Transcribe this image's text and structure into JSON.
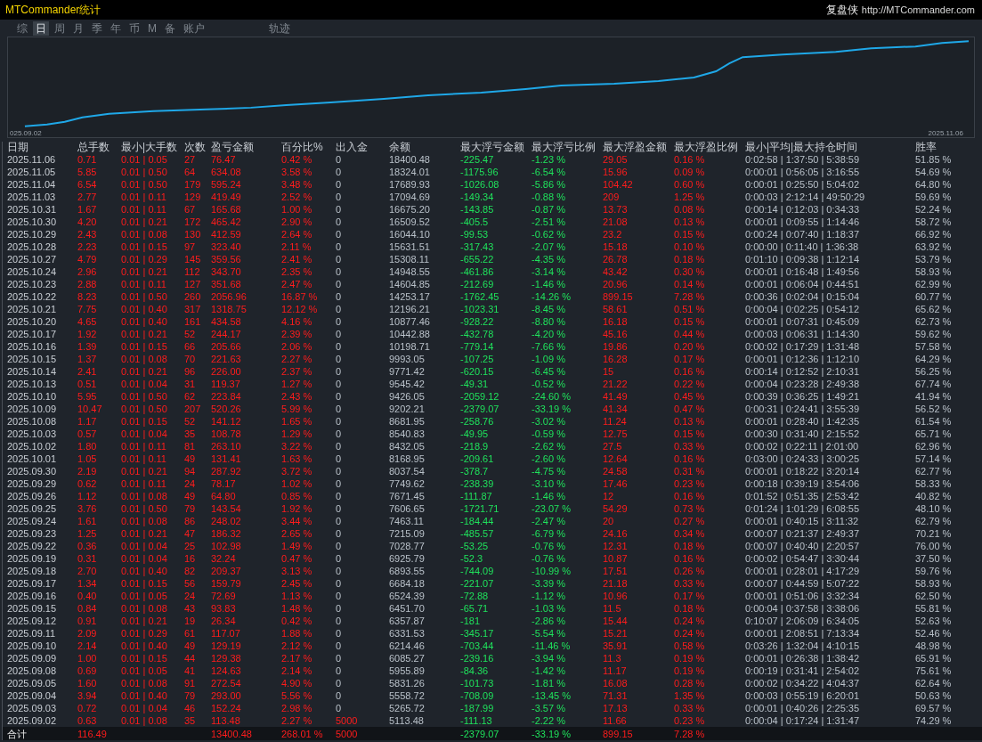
{
  "window": {
    "title": "MTCommander统计",
    "brand": "复盘侠",
    "url": "http://MTCommander.com"
  },
  "tabs": [
    {
      "label": "综",
      "selected": false
    },
    {
      "label": "日",
      "selected": true
    },
    {
      "label": "周",
      "selected": false
    },
    {
      "label": "月",
      "selected": false
    },
    {
      "label": "季",
      "selected": false
    },
    {
      "label": "年",
      "selected": false
    },
    {
      "label": "币",
      "selected": false
    },
    {
      "label": "M",
      "selected": false
    },
    {
      "label": "备",
      "selected": false
    },
    {
      "label": "账户",
      "selected": false
    }
  ],
  "right_tabs": [
    {
      "label": "轨迹",
      "selected": false
    }
  ],
  "chart": {
    "start_label": "025.09.02",
    "end_label": "2025.11.06"
  },
  "table": {
    "columns": [
      {
        "label": "日期",
        "kind": "label"
      },
      {
        "label": "总手数",
        "kind": "up"
      },
      {
        "label": "最小|大手数",
        "kind": "up"
      },
      {
        "label": "次数",
        "kind": "up"
      },
      {
        "label": "盈亏金额",
        "kind": "up"
      },
      {
        "label": "百分比%",
        "kind": "up"
      },
      {
        "label": "出入金",
        "kind": "transfer"
      },
      {
        "label": "余额",
        "kind": "plain"
      },
      {
        "label": "最大浮亏金额",
        "kind": "down"
      },
      {
        "label": "最大浮亏比例",
        "kind": "down"
      },
      {
        "label": "最大浮盈金额",
        "kind": "up"
      },
      {
        "label": "最大浮盈比例",
        "kind": "up"
      },
      {
        "label": "最小|平均|最大持仓时间",
        "kind": "plain"
      },
      {
        "label": "胜率",
        "kind": "plain"
      }
    ],
    "rows": [
      {
        "cells": [
          "2025.11.06",
          "0.71",
          "0.01 | 0.05",
          "27",
          "76.47",
          "0.42 %",
          "0",
          "18400.48",
          "-225.47",
          "-1.23 %",
          "29.05",
          "0.16 %",
          "0:02:58 | 1:37:50 | 5:38:59",
          "51.85 %"
        ],
        "transfer": false
      },
      {
        "cells": [
          "2025.11.05",
          "5.85",
          "0.01 | 0.50",
          "64",
          "634.08",
          "3.58 %",
          "0",
          "18324.01",
          "-1175.96",
          "-6.54 %",
          "15.96",
          "0.09 %",
          "0:00:01 | 0:56:05 | 3:16:55",
          "54.69 %"
        ],
        "transfer": false
      },
      {
        "cells": [
          "2025.11.04",
          "6.54",
          "0.01 | 0.50",
          "179",
          "595.24",
          "3.48 %",
          "0",
          "17689.93",
          "-1026.08",
          "-5.86 %",
          "104.42",
          "0.60 %",
          "0:00:01 | 0:25:50 | 5:04:02",
          "64.80 %"
        ],
        "transfer": false
      },
      {
        "cells": [
          "2025.11.03",
          "2.77",
          "0.01 | 0.11",
          "129",
          "419.49",
          "2.52 %",
          "0",
          "17094.69",
          "-149.34",
          "-0.88 %",
          "209",
          "1.25 %",
          "0:00:03 | 2:12:14 | 49:50:29",
          "59.69 %"
        ],
        "transfer": false
      },
      {
        "cells": [
          "2025.10.31",
          "1.67",
          "0.01 | 0.11",
          "67",
          "165.68",
          "1.00 %",
          "0",
          "16675.20",
          "-143.85",
          "-0.87 %",
          "13.73",
          "0.08 %",
          "0:00:14 | 0:12:03 | 0:34:33",
          "52.24 %"
        ],
        "transfer": false
      },
      {
        "cells": [
          "2025.10.30",
          "4.20",
          "0.01 | 0.21",
          "172",
          "465.42",
          "2.90 %",
          "0",
          "16509.52",
          "-405.5",
          "-2.51 %",
          "21.08",
          "0.13 %",
          "0:00:01 | 0:09:55 | 1:14:46",
          "58.72 %"
        ],
        "transfer": false
      },
      {
        "cells": [
          "2025.10.29",
          "2.43",
          "0.01 | 0.08",
          "130",
          "412.59",
          "2.64 %",
          "0",
          "16044.10",
          "-99.53",
          "-0.62 %",
          "23.2",
          "0.15 %",
          "0:00:24 | 0:07:40 | 1:18:37",
          "66.92 %"
        ],
        "transfer": false
      },
      {
        "cells": [
          "2025.10.28",
          "2.23",
          "0.01 | 0.15",
          "97",
          "323.40",
          "2.11 %",
          "0",
          "15631.51",
          "-317.43",
          "-2.07 %",
          "15.18",
          "0.10 %",
          "0:00:00 | 0:11:40 | 1:36:38",
          "63.92 %"
        ],
        "transfer": false
      },
      {
        "cells": [
          "2025.10.27",
          "4.79",
          "0.01 | 0.29",
          "145",
          "359.56",
          "2.41 %",
          "0",
          "15308.11",
          "-655.22",
          "-4.35 %",
          "26.78",
          "0.18 %",
          "0:01:10 | 0:09:38 | 1:12:14",
          "53.79 %"
        ],
        "transfer": false
      },
      {
        "cells": [
          "2025.10.24",
          "2.96",
          "0.01 | 0.21",
          "112",
          "343.70",
          "2.35 %",
          "0",
          "14948.55",
          "-461.86",
          "-3.14 %",
          "43.42",
          "0.30 %",
          "0:00:01 | 0:16:48 | 1:49:56",
          "58.93 %"
        ],
        "transfer": false
      },
      {
        "cells": [
          "2025.10.23",
          "2.88",
          "0.01 | 0.11",
          "127",
          "351.68",
          "2.47 %",
          "0",
          "14604.85",
          "-212.69",
          "-1.46 %",
          "20.96",
          "0.14 %",
          "0:00:01 | 0:06:04 | 0:44:51",
          "62.99 %"
        ],
        "transfer": false
      },
      {
        "cells": [
          "2025.10.22",
          "8.23",
          "0.01 | 0.50",
          "260",
          "2056.96",
          "16.87 %",
          "0",
          "14253.17",
          "-1762.45",
          "-14.26 %",
          "899.15",
          "7.28 %",
          "0:00:36 | 0:02:04 | 0:15:04",
          "60.77 %"
        ],
        "transfer": false
      },
      {
        "cells": [
          "2025.10.21",
          "7.75",
          "0.01 | 0.40",
          "317",
          "1318.75",
          "12.12 %",
          "0",
          "12196.21",
          "-1023.31",
          "-8.45 %",
          "58.61",
          "0.51 %",
          "0:00:04 | 0:02:25 | 0:54:12",
          "65.62 %"
        ],
        "transfer": false
      },
      {
        "cells": [
          "2025.10.20",
          "4.65",
          "0.01 | 0.40",
          "161",
          "434.58",
          "4.16 %",
          "0",
          "10877.46",
          "-928.22",
          "-8.80 %",
          "16.18",
          "0.15 %",
          "0:00:01 | 0:07:31 | 0:45:09",
          "62.73 %"
        ],
        "transfer": false
      },
      {
        "cells": [
          "2025.10.17",
          "1.92",
          "0.01 | 0.21",
          "52",
          "244.17",
          "2.39 %",
          "0",
          "10442.88",
          "-432.78",
          "-4.20 %",
          "45.16",
          "0.44 %",
          "0:00:03 | 0:06:31 | 1:14:30",
          "59.62 %"
        ],
        "transfer": false
      },
      {
        "cells": [
          "2025.10.16",
          "1.39",
          "0.01 | 0.15",
          "66",
          "205.66",
          "2.06 %",
          "0",
          "10198.71",
          "-779.14",
          "-7.66 %",
          "19.86",
          "0.20 %",
          "0:00:02 | 0:17:29 | 1:31:48",
          "57.58 %"
        ],
        "transfer": false
      },
      {
        "cells": [
          "2025.10.15",
          "1.37",
          "0.01 | 0.08",
          "70",
          "221.63",
          "2.27 %",
          "0",
          "9993.05",
          "-107.25",
          "-1.09 %",
          "16.28",
          "0.17 %",
          "0:00:01 | 0:12:36 | 1:12:10",
          "64.29 %"
        ],
        "transfer": false
      },
      {
        "cells": [
          "2025.10.14",
          "2.41",
          "0.01 | 0.21",
          "96",
          "226.00",
          "2.37 %",
          "0",
          "9771.42",
          "-620.15",
          "-6.45 %",
          "15",
          "0.16 %",
          "0:00:14 | 0:12:52 | 2:10:31",
          "56.25 %"
        ],
        "transfer": false
      },
      {
        "cells": [
          "2025.10.13",
          "0.51",
          "0.01 | 0.04",
          "31",
          "119.37",
          "1.27 %",
          "0",
          "9545.42",
          "-49.31",
          "-0.52 %",
          "21.22",
          "0.22 %",
          "0:00:04 | 0:23:28 | 2:49:38",
          "67.74 %"
        ],
        "transfer": false
      },
      {
        "cells": [
          "2025.10.10",
          "5.95",
          "0.01 | 0.50",
          "62",
          "223.84",
          "2.43 %",
          "0",
          "9426.05",
          "-2059.12",
          "-24.60 %",
          "41.49",
          "0.45 %",
          "0:00:39 | 0:36:25 | 1:49:21",
          "41.94 %"
        ],
        "transfer": false
      },
      {
        "cells": [
          "2025.10.09",
          "10.47",
          "0.01 | 0.50",
          "207",
          "520.26",
          "5.99 %",
          "0",
          "9202.21",
          "-2379.07",
          "-33.19 %",
          "41.34",
          "0.47 %",
          "0:00:31 | 0:24:41 | 3:55:39",
          "56.52 %"
        ],
        "transfer": false
      },
      {
        "cells": [
          "2025.10.08",
          "1.17",
          "0.01 | 0.15",
          "52",
          "141.12",
          "1.65 %",
          "0",
          "8681.95",
          "-258.76",
          "-3.02 %",
          "11.24",
          "0.13 %",
          "0:00:01 | 0:28:40 | 1:42:35",
          "61.54 %"
        ],
        "transfer": false
      },
      {
        "cells": [
          "2025.10.03",
          "0.57",
          "0.01 | 0.04",
          "35",
          "108.78",
          "1.29 %",
          "0",
          "8540.83",
          "-49.95",
          "-0.59 %",
          "12.75",
          "0.15 %",
          "0:00:30 | 0:31:40 | 2:15:52",
          "65.71 %"
        ],
        "transfer": false
      },
      {
        "cells": [
          "2025.10.02",
          "1.80",
          "0.01 | 0.11",
          "81",
          "263.10",
          "3.22 %",
          "0",
          "8432.05",
          "-218.9",
          "-2.62 %",
          "27.5",
          "0.33 %",
          "0:00:02 | 0:22:11 | 2:01:00",
          "62.96 %"
        ],
        "transfer": false
      },
      {
        "cells": [
          "2025.10.01",
          "1.05",
          "0.01 | 0.11",
          "49",
          "131.41",
          "1.63 %",
          "0",
          "8168.95",
          "-209.61",
          "-2.60 %",
          "12.64",
          "0.16 %",
          "0:03:00 | 0:24:33 | 3:00:25",
          "57.14 %"
        ],
        "transfer": false
      },
      {
        "cells": [
          "2025.09.30",
          "2.19",
          "0.01 | 0.21",
          "94",
          "287.92",
          "3.72 %",
          "0",
          "8037.54",
          "-378.7",
          "-4.75 %",
          "24.58",
          "0.31 %",
          "0:00:01 | 0:18:22 | 3:20:14",
          "62.77 %"
        ],
        "transfer": false
      },
      {
        "cells": [
          "2025.09.29",
          "0.62",
          "0.01 | 0.11",
          "24",
          "78.17",
          "1.02 %",
          "0",
          "7749.62",
          "-238.39",
          "-3.10 %",
          "17.46",
          "0.23 %",
          "0:00:18 | 0:39:19 | 3:54:06",
          "58.33 %"
        ],
        "transfer": false
      },
      {
        "cells": [
          "2025.09.26",
          "1.12",
          "0.01 | 0.08",
          "49",
          "64.80",
          "0.85 %",
          "0",
          "7671.45",
          "-111.87",
          "-1.46 %",
          "12",
          "0.16 %",
          "0:01:52 | 0:51:35 | 2:53:42",
          "40.82 %"
        ],
        "transfer": false
      },
      {
        "cells": [
          "2025.09.25",
          "3.76",
          "0.01 | 0.50",
          "79",
          "143.54",
          "1.92 %",
          "0",
          "7606.65",
          "-1721.71",
          "-23.07 %",
          "54.29",
          "0.73 %",
          "0:01:24 | 1:01:29 | 6:08:55",
          "48.10 %"
        ],
        "transfer": false
      },
      {
        "cells": [
          "2025.09.24",
          "1.61",
          "0.01 | 0.08",
          "86",
          "248.02",
          "3.44 %",
          "0",
          "7463.11",
          "-184.44",
          "-2.47 %",
          "20",
          "0.27 %",
          "0:00:01 | 0:40:15 | 3:11:32",
          "62.79 %"
        ],
        "transfer": false
      },
      {
        "cells": [
          "2025.09.23",
          "1.25",
          "0.01 | 0.21",
          "47",
          "186.32",
          "2.65 %",
          "0",
          "7215.09",
          "-485.57",
          "-6.79 %",
          "24.16",
          "0.34 %",
          "0:00:07 | 0:21:37 | 2:49:37",
          "70.21 %"
        ],
        "transfer": false
      },
      {
        "cells": [
          "2025.09.22",
          "0.36",
          "0.01 | 0.04",
          "25",
          "102.98",
          "1.49 %",
          "0",
          "7028.77",
          "-53.25",
          "-0.76 %",
          "12.31",
          "0.18 %",
          "0:00:07 | 0:40:40 | 2:20:57",
          "76.00 %"
        ],
        "transfer": false
      },
      {
        "cells": [
          "2025.09.19",
          "0.31",
          "0.01 | 0.04",
          "16",
          "32.24",
          "0.47 %",
          "0",
          "6925.79",
          "-52.3",
          "-0.76 %",
          "10.87",
          "0.16 %",
          "0:00:02 | 0:54:47 | 3:30:44",
          "37.50 %"
        ],
        "transfer": false
      },
      {
        "cells": [
          "2025.09.18",
          "2.70",
          "0.01 | 0.40",
          "82",
          "209.37",
          "3.13 %",
          "0",
          "6893.55",
          "-744.09",
          "-10.99 %",
          "17.51",
          "0.26 %",
          "0:00:01 | 0:28:01 | 4:17:29",
          "59.76 %"
        ],
        "transfer": false
      },
      {
        "cells": [
          "2025.09.17",
          "1.34",
          "0.01 | 0.15",
          "56",
          "159.79",
          "2.45 %",
          "0",
          "6684.18",
          "-221.07",
          "-3.39 %",
          "21.18",
          "0.33 %",
          "0:00:07 | 0:44:59 | 5:07:22",
          "58.93 %"
        ],
        "transfer": false
      },
      {
        "cells": [
          "2025.09.16",
          "0.40",
          "0.01 | 0.05",
          "24",
          "72.69",
          "1.13 %",
          "0",
          "6524.39",
          "-72.88",
          "-1.12 %",
          "10.96",
          "0.17 %",
          "0:00:01 | 0:51:06 | 3:32:34",
          "62.50 %"
        ],
        "transfer": false
      },
      {
        "cells": [
          "2025.09.15",
          "0.84",
          "0.01 | 0.08",
          "43",
          "93.83",
          "1.48 %",
          "0",
          "6451.70",
          "-65.71",
          "-1.03 %",
          "11.5",
          "0.18 %",
          "0:00:04 | 0:37:58 | 3:38:06",
          "55.81 %"
        ],
        "transfer": false
      },
      {
        "cells": [
          "2025.09.12",
          "0.91",
          "0.01 | 0.21",
          "19",
          "26.34",
          "0.42 %",
          "0",
          "6357.87",
          "-181",
          "-2.86 %",
          "15.44",
          "0.24 %",
          "0:10:07 | 2:06:09 | 6:34:05",
          "52.63 %"
        ],
        "transfer": false
      },
      {
        "cells": [
          "2025.09.11",
          "2.09",
          "0.01 | 0.29",
          "61",
          "117.07",
          "1.88 %",
          "0",
          "6331.53",
          "-345.17",
          "-5.54 %",
          "15.21",
          "0.24 %",
          "0:00:01 | 2:08:51 | 7:13:34",
          "52.46 %"
        ],
        "transfer": false
      },
      {
        "cells": [
          "2025.09.10",
          "2.14",
          "0.01 | 0.40",
          "49",
          "129.19",
          "2.12 %",
          "0",
          "6214.46",
          "-703.44",
          "-11.46 %",
          "35.91",
          "0.58 %",
          "0:03:26 | 1:32:04 | 4:10:15",
          "48.98 %"
        ],
        "transfer": false
      },
      {
        "cells": [
          "2025.09.09",
          "1.00",
          "0.01 | 0.15",
          "44",
          "129.38",
          "2.17 %",
          "0",
          "6085.27",
          "-239.16",
          "-3.94 %",
          "11.3",
          "0.19 %",
          "0:00:01 | 0:26:38 | 1:38:42",
          "65.91 %"
        ],
        "transfer": false
      },
      {
        "cells": [
          "2025.09.08",
          "0.69",
          "0.01 | 0.05",
          "41",
          "124.63",
          "2.14 %",
          "0",
          "5955.89",
          "-84.36",
          "-1.42 %",
          "11.17",
          "0.19 %",
          "0:00:19 | 0:31:41 | 2:54:02",
          "75.61 %"
        ],
        "transfer": false
      },
      {
        "cells": [
          "2025.09.05",
          "1.60",
          "0.01 | 0.08",
          "91",
          "272.54",
          "4.90 %",
          "0",
          "5831.26",
          "-101.73",
          "-1.81 %",
          "16.08",
          "0.28 %",
          "0:00:02 | 0:34:22 | 4:04:37",
          "62.64 %"
        ],
        "transfer": false
      },
      {
        "cells": [
          "2025.09.04",
          "3.94",
          "0.01 | 0.40",
          "79",
          "293.00",
          "5.56 %",
          "0",
          "5558.72",
          "-708.09",
          "-13.45 %",
          "71.31",
          "1.35 %",
          "0:00:03 | 0:55:19 | 6:20:01",
          "50.63 %"
        ],
        "transfer": false
      },
      {
        "cells": [
          "2025.09.03",
          "0.72",
          "0.01 | 0.04",
          "46",
          "152.24",
          "2.98 %",
          "0",
          "5265.72",
          "-187.99",
          "-3.57 %",
          "17.13",
          "0.33 %",
          "0:00:01 | 0:40:26 | 2:25:35",
          "69.57 %"
        ],
        "transfer": false
      },
      {
        "cells": [
          "2025.09.02",
          "0.63",
          "0.01 | 0.08",
          "35",
          "113.48",
          "2.27 %",
          "5000",
          "5113.48",
          "-111.13",
          "-2.22 %",
          "11.66",
          "0.23 %",
          "0:00:04 | 0:17:24 | 1:31:47",
          "74.29 %"
        ],
        "transfer": true
      }
    ],
    "total": {
      "cells": [
        "合计",
        "116.49",
        null,
        null,
        "13400.48",
        "268.01 %",
        "5000",
        null,
        "-2379.07",
        "-33.19 %",
        "899.15",
        "7.28 %",
        null,
        null
      ],
      "transfer": true
    }
  }
}
